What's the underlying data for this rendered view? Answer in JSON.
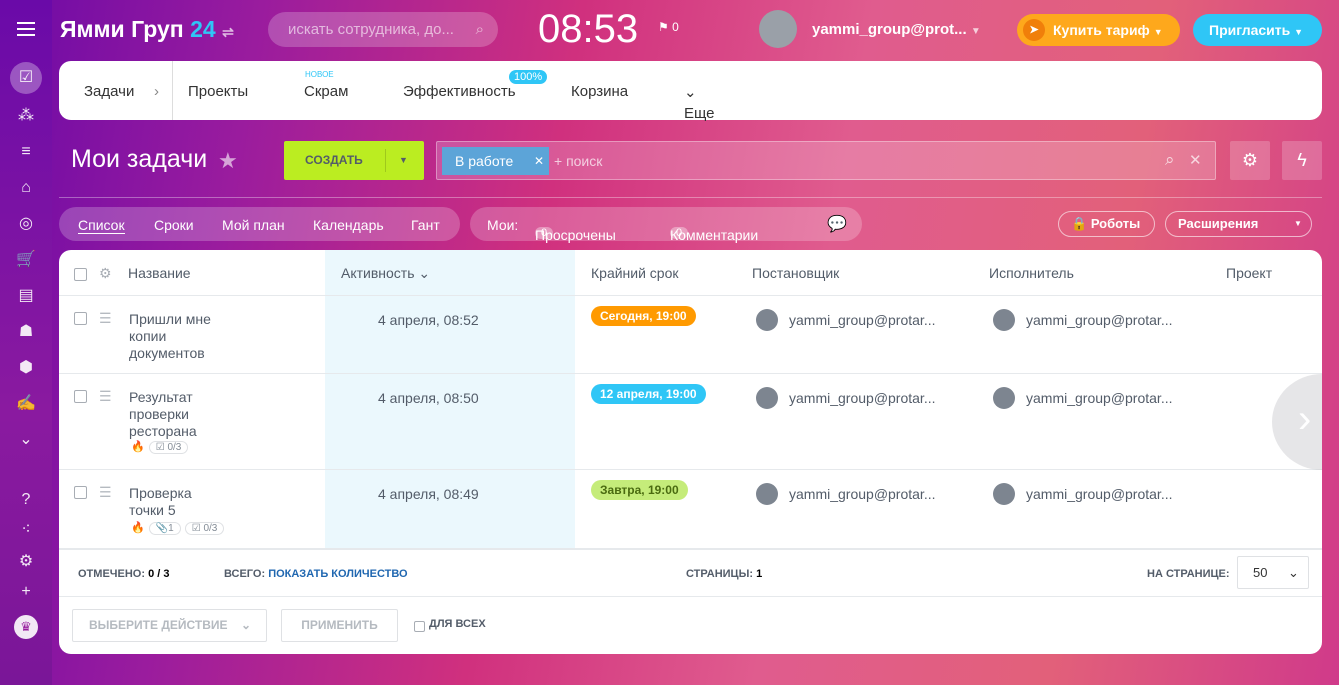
{
  "header": {
    "logo": "Ямми Груп",
    "logo_num": "24",
    "search_placeholder": "искать сотрудника, до...",
    "clock": "08:53",
    "flag_count": "0",
    "user": "yammi_group@prot...",
    "buy": "Купить тариф",
    "invite": "Пригласить"
  },
  "nav": {
    "tasks": "Задачи",
    "projects": "Проекты",
    "scrum": "Скрам",
    "scrum_badge": "новое",
    "efficiency": "Эффективность",
    "eff_badge": "100%",
    "trash": "Корзина",
    "more": "Еще"
  },
  "toolbar": {
    "title": "Мои задачи",
    "create": "СОЗДАТЬ",
    "filter_tag": "В работе",
    "filter_placeholder": "+ поиск"
  },
  "views": {
    "items": [
      "Список",
      "Сроки",
      "Мой план",
      "Календарь",
      "Гант"
    ]
  },
  "mine": {
    "label": "Мои:",
    "overdue_count": "0",
    "overdue": "Просрочены",
    "comments_count": "0",
    "comments": "Комментарии"
  },
  "right": {
    "robots": "Роботы",
    "extensions": "Расширения"
  },
  "table": {
    "columns": [
      "Название",
      "Активность",
      "Крайний срок",
      "Постановщик",
      "Исполнитель",
      "Проект"
    ],
    "rows": [
      {
        "name": "Пришли мне копии документов",
        "activity": "4 апреля, 08:52",
        "deadline": "Сегодня, 19:00",
        "creator": "yammi_group@protar...",
        "assignee": "yammi_group@protar..."
      },
      {
        "name": "Результат проверки ресторана",
        "activity": "4 апреля, 08:50",
        "deadline": "12 апреля, 19:00",
        "creator": "yammi_group@protar...",
        "assignee": "yammi_group@protar...",
        "checklist": "0/3"
      },
      {
        "name": "Проверка точки 5",
        "activity": "4 апреля, 08:49",
        "deadline": "Завтра, 19:00",
        "creator": "yammi_group@protar...",
        "assignee": "yammi_group@protar...",
        "files": "1",
        "checklist": "0/3"
      }
    ]
  },
  "footer": {
    "checked_label": "ОТМЕЧЕНО:",
    "checked": "0 / 3",
    "total_label": "ВСЕГО:",
    "total_link": "ПОКАЗАТЬ КОЛИЧЕСТВО",
    "pages_label": "СТРАНИЦЫ:",
    "pages": "1",
    "per_page_label": "НА СТРАНИЦЕ:",
    "per_page": "50",
    "action": "ВЫБЕРИТЕ ДЕЙСТВИЕ",
    "apply": "ПРИМЕНИТЬ",
    "for_all": "ДЛЯ ВСЕХ"
  },
  "colors": {
    "today": "#ff9a01",
    "date": "#2fc6f6",
    "tomorrow": "#c5ec7a"
  }
}
